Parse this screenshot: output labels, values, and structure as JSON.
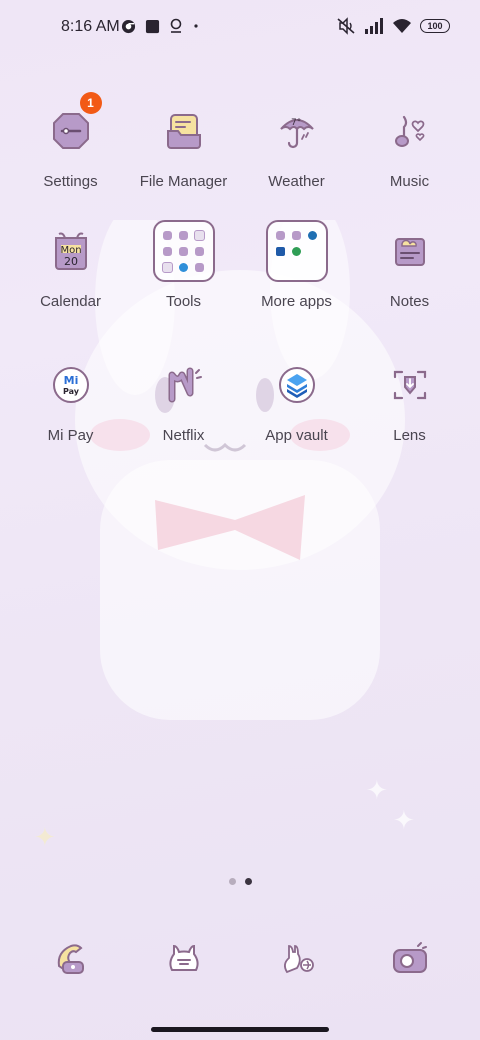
{
  "status_bar": {
    "time": "8:16 AM",
    "battery": "100",
    "left_icons": [
      "chrome-icon",
      "stop-icon",
      "location-icon",
      "dot-icon"
    ],
    "right_icons": [
      "mute-icon",
      "signal-icon",
      "wifi-icon",
      "battery-icon"
    ]
  },
  "apps": [
    {
      "label": "Settings",
      "icon": "settings-icon",
      "badge": "1"
    },
    {
      "label": "File Manager",
      "icon": "file-manager-icon"
    },
    {
      "label": "Weather",
      "icon": "weather-icon",
      "text": "7°"
    },
    {
      "label": "Music",
      "icon": "music-icon"
    },
    {
      "label": "Calendar",
      "icon": "calendar-icon",
      "day_name": "Mon",
      "day_number": "20"
    },
    {
      "label": "Tools",
      "icon": "folder-icon"
    },
    {
      "label": "More apps",
      "icon": "folder-icon"
    },
    {
      "label": "Notes",
      "icon": "notes-icon"
    },
    {
      "label": "Mi Pay",
      "icon": "mi-pay-icon",
      "logo_text": "Pay"
    },
    {
      "label": "Netflix",
      "icon": "netflix-icon"
    },
    {
      "label": "App vault",
      "icon": "app-vault-icon"
    },
    {
      "label": "Lens",
      "icon": "lens-icon"
    }
  ],
  "pages": {
    "count": 2,
    "active": 2
  },
  "dock": [
    {
      "icon": "phone-icon"
    },
    {
      "icon": "messages-icon"
    },
    {
      "icon": "browser-icon"
    },
    {
      "icon": "camera-icon"
    }
  ],
  "colors": {
    "icon_purple": "#b79ac8",
    "icon_stroke": "#8b6a8c",
    "badge": "#f25a16",
    "background": "#efe6f6"
  }
}
